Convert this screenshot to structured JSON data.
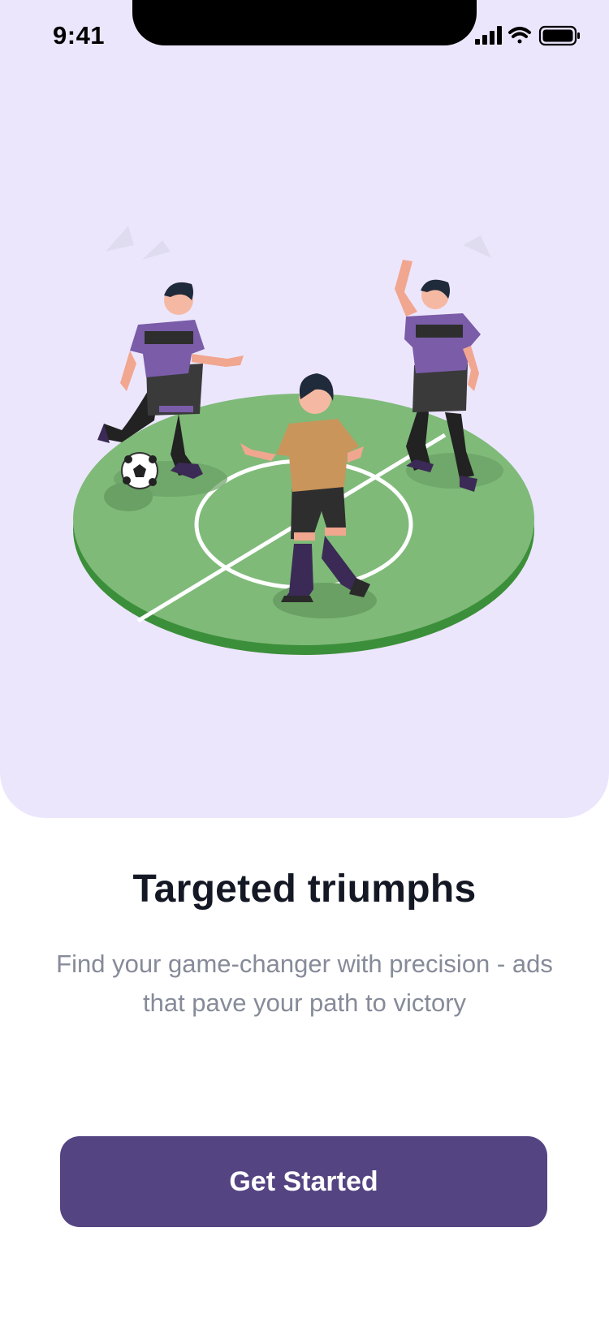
{
  "status_bar": {
    "time": "9:41",
    "icons": [
      "signal-icon",
      "wifi-icon",
      "battery-icon"
    ]
  },
  "hero": {
    "background": "#ece6fd",
    "illustration": "soccer-players-illustration"
  },
  "onboarding": {
    "title": "Targeted triumphs",
    "subtitle": "Find your game-changer with precision - ads that pave your path to victory"
  },
  "cta": {
    "label": "Get Started",
    "color": "#544482"
  },
  "colors": {
    "jersey": "#7a5ca8",
    "field": "#7fba79",
    "field_edge": "#3c8f3a",
    "title_text": "#141824",
    "subtitle_text": "#868b99"
  }
}
